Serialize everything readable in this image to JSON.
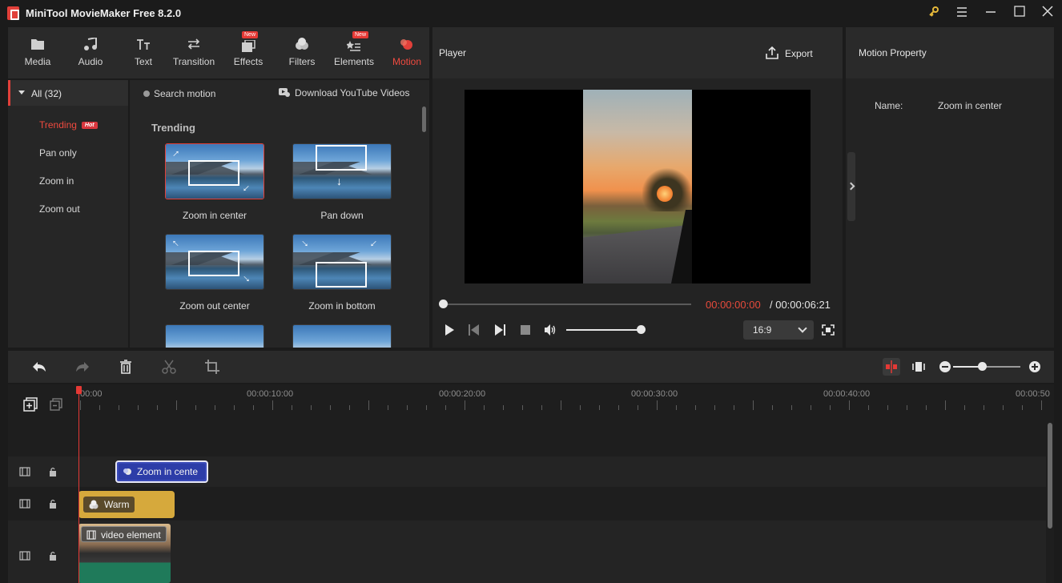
{
  "app": {
    "title": "MiniTool MovieMaker Free 8.2.0"
  },
  "toolbar": {
    "tabs": [
      {
        "label": "Media",
        "icon": "folder-icon"
      },
      {
        "label": "Audio",
        "icon": "music-note-icon"
      },
      {
        "label": "Text",
        "icon": "text-icon"
      },
      {
        "label": "Transition",
        "icon": "transition-icon"
      },
      {
        "label": "Effects",
        "icon": "effects-icon",
        "badge": "New"
      },
      {
        "label": "Filters",
        "icon": "filters-icon"
      },
      {
        "label": "Elements",
        "icon": "elements-icon",
        "badge": "New"
      },
      {
        "label": "Motion",
        "icon": "motion-icon",
        "active": true
      }
    ]
  },
  "categories": {
    "all_label": "All (32)",
    "items": [
      {
        "label": "Trending",
        "badge": "Hot",
        "active": true
      },
      {
        "label": "Pan only"
      },
      {
        "label": "Zoom in"
      },
      {
        "label": "Zoom out"
      }
    ]
  },
  "library": {
    "search_placeholder": "Search motion",
    "download_label": "Download YouTube Videos",
    "section_title": "Trending",
    "items": [
      {
        "label": "Zoom in center",
        "selected": true
      },
      {
        "label": "Pan down"
      },
      {
        "label": "Zoom out center"
      },
      {
        "label": "Zoom in bottom"
      }
    ]
  },
  "player": {
    "title": "Player",
    "export_label": "Export",
    "time_current": "00:00:00:00",
    "time_total": "/ 00:00:06:21",
    "aspect_ratio": "16:9",
    "progress_fraction": 0,
    "volume_fraction": 1
  },
  "property": {
    "title": "Motion Property",
    "name_label": "Name:",
    "name_value": "Zoom in center"
  },
  "timeline": {
    "ruler_labels": [
      "00:00",
      "00:00:10:00",
      "00:00:20:00",
      "00:00:30:00",
      "00:00:40:00",
      "00:00:50"
    ],
    "motion_clip": "Zoom in cente",
    "filter_clip": "Warm",
    "video_clip": "video element",
    "zoom_fraction": 0.45
  },
  "colors": {
    "accent": "#e2403a",
    "motion_clip": "#3b4bb8",
    "filter_clip": "#d6a93c",
    "video_clip_bottom": "#1f7a5a"
  }
}
